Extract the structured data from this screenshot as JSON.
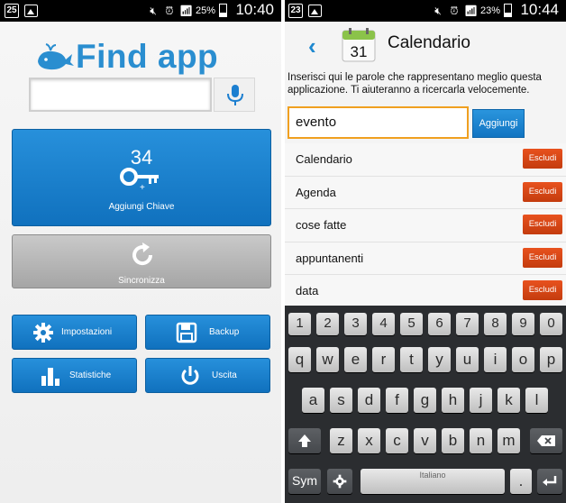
{
  "left": {
    "status": {
      "notif": "25",
      "battery": "25%",
      "time": "10:40"
    },
    "app_title": "Find app",
    "search": {
      "value": "",
      "placeholder": ""
    },
    "key_count": "34",
    "key_button_label": "Aggiungi Chiave",
    "sync_button_label": "Sincronizza",
    "buttons": [
      {
        "label": "Impostazioni",
        "icon": "gear-icon"
      },
      {
        "label": "Backup",
        "icon": "floppy-icon"
      },
      {
        "label": "Statistiche",
        "icon": "bar-chart-icon"
      },
      {
        "label": "Uscita",
        "icon": "power-icon"
      }
    ],
    "colors": {
      "accent": "#1a82cc",
      "title": "#2a8ed0"
    }
  },
  "right": {
    "status": {
      "notif": "23",
      "battery": "23%",
      "time": "10:44"
    },
    "calendar_day": "31",
    "title": "Calendario",
    "instructions": "Inserisci qui le parole che rappresentano meglio questa applicazione. Ti aiuteranno a ricercarla velocemente.",
    "input_value": "evento",
    "add_button": "Aggiungi",
    "exclude_label": "Escludi",
    "tags": [
      "Calendario",
      "Agenda",
      "cose fatte",
      "appuntanenti",
      "data"
    ],
    "keyboard": {
      "numbers": [
        "1",
        "2",
        "3",
        "4",
        "5",
        "6",
        "7",
        "8",
        "9",
        "0"
      ],
      "row1": [
        "q",
        "w",
        "e",
        "r",
        "t",
        "y",
        "u",
        "i",
        "o",
        "p"
      ],
      "row2": [
        "a",
        "s",
        "d",
        "f",
        "g",
        "h",
        "j",
        "k",
        "l"
      ],
      "row3": [
        "z",
        "x",
        "c",
        "v",
        "b",
        "n",
        "m"
      ],
      "sym": "Sym",
      "space": "Italiano",
      "colors": {
        "exclude": "#d84a16",
        "input_border": "#f0a020"
      }
    }
  }
}
